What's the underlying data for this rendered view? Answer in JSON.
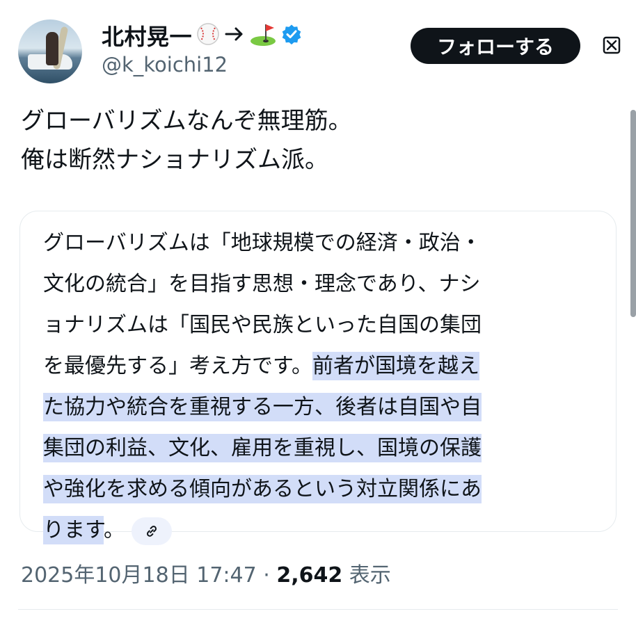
{
  "author": {
    "display_name": "北村晃一",
    "handle": "@k_koichi12",
    "name_icons": [
      "baseball-icon",
      "arrow-right-icon",
      "golf-icon",
      "verified-badge-icon"
    ],
    "verified_color": "#1d9bf0"
  },
  "follow_button": {
    "label": "フォローする"
  },
  "tweet": {
    "lines": [
      "グローバリズムなんぞ無理筋。",
      "俺は断然ナショナリズム派。"
    ]
  },
  "card": {
    "lines": [
      "グローバリズムは「地球規模での経済・政治・",
      "文化の統合」を目指す思想・理念であり、ナシ",
      "ョナリズムは「国民や民族といった自国の集団",
      "を最優先する」考え方です。",
      "前者が国境を越え",
      "た協力や統合を重視する一方、後者は自国や自",
      "集団の利益、文化、雇用を重視し、国境の保護",
      "や強化を求める傾向があるという対立関係にあ",
      "ります",
      "。"
    ],
    "highlight_color": "#d2ddf8",
    "link_icon": "link-icon"
  },
  "meta": {
    "timestamp": "2025年10月18日 17:47",
    "separator": "·",
    "views_count": "2,642",
    "views_label": "表示"
  }
}
